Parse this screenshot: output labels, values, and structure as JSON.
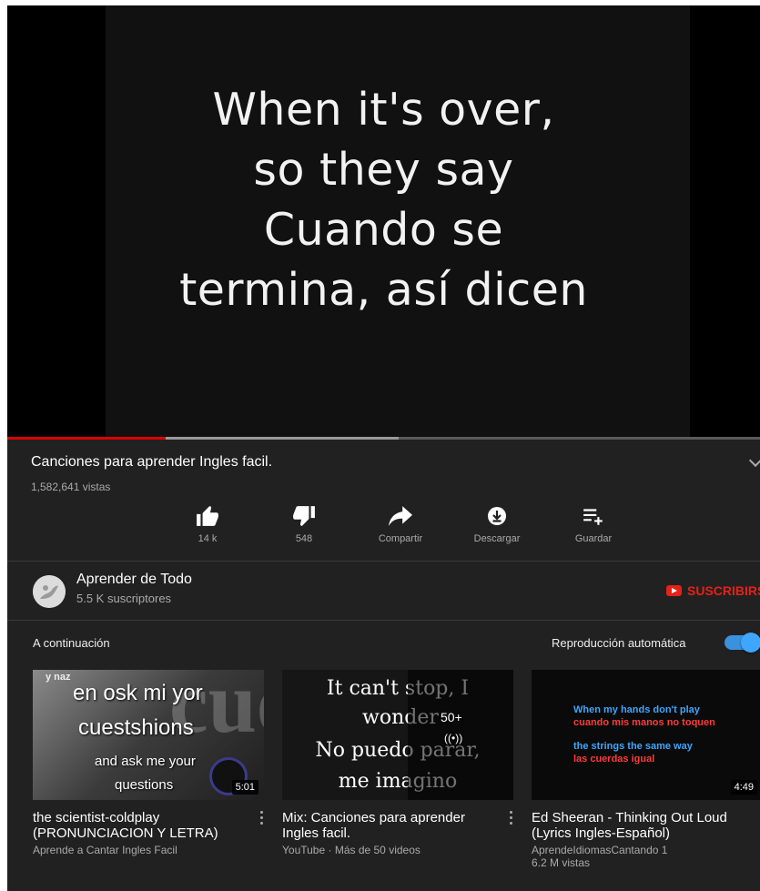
{
  "video": {
    "lyrics": [
      "When it's over,",
      "so they say",
      "Cuando se",
      "termina, así dicen"
    ],
    "progress": 0.21,
    "buffered": 0.52
  },
  "info": {
    "title": "Canciones para aprender Ingles facil.",
    "views": "1,582,641 vistas"
  },
  "actions": [
    {
      "label": "14 k",
      "icon": "thumbs-up-icon"
    },
    {
      "label": "548",
      "icon": "thumbs-down-icon"
    },
    {
      "label": "Compartir",
      "icon": "share-icon"
    },
    {
      "label": "Descargar",
      "icon": "download-icon"
    },
    {
      "label": "Guardar",
      "icon": "playlist-add-icon"
    }
  ],
  "channel": {
    "name": "Aprender de Todo",
    "subscribers": "5.5 K suscriptores",
    "subscribe_label": "SUSCRIBIRS"
  },
  "upnext": {
    "label": "A continuación",
    "autoplay_label": "Reproducción automática",
    "autoplay_on": true
  },
  "cards": [
    {
      "thumb_lines": [
        "y naz",
        "en osk mi yor",
        "cuestshions",
        "and ask me your",
        "questions"
      ],
      "thumb_bigtext": "cue",
      "duration": "5:01",
      "title": "the scientist-coldplay (PRONUNCIACION Y LETRA)",
      "channel": "Aprende a Cantar Ingles Facil",
      "views": ""
    },
    {
      "thumb_lines": [
        "It can't stop, I",
        "wonder",
        "No puedo parar,",
        "me imagino"
      ],
      "count": "50+",
      "mix_icon": "((•))",
      "title": "Mix: Canciones para aprender Ingles facil.",
      "meta": "YouTube · Más de 50 videos"
    },
    {
      "thumb_lines": [
        "When my hands don't play",
        "cuando mis manos no toquen",
        "the strings the same way",
        "las cuerdas igual"
      ],
      "duration": "4:49",
      "title": "Ed Sheeran - Thinking Out Loud (Lyrics Ingles-Español)",
      "channel": "AprendeIdiomasCantando 1",
      "views": "6.2 M vistas"
    }
  ],
  "colors": {
    "background": "#212121",
    "accent": "#3ea6ff",
    "brand": "#e62117"
  }
}
